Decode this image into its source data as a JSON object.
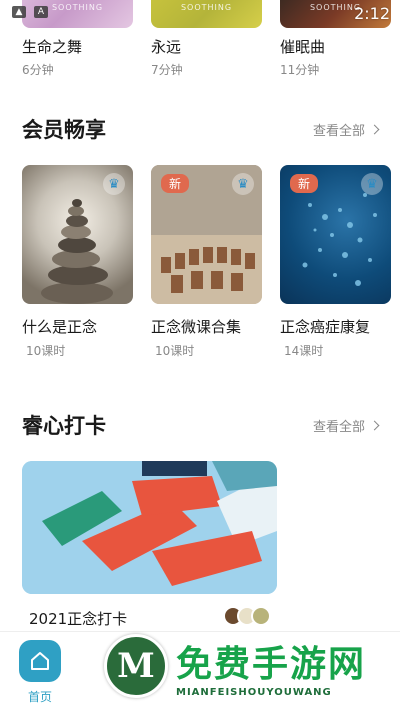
{
  "status": {
    "time": "2:12"
  },
  "top_tracks": [
    {
      "title": "生命之舞",
      "duration": "6分钟",
      "brand": "SOOTHING"
    },
    {
      "title": "永远",
      "duration": "7分钟",
      "brand": "SOOTHING"
    },
    {
      "title": "催眠曲",
      "duration": "11分钟",
      "brand": "SOOTHING"
    }
  ],
  "member_section": {
    "title": "会员畅享",
    "view_all": "查看全部",
    "items": [
      {
        "title": "什么是正念",
        "lessons": "10课时",
        "badge": ""
      },
      {
        "title": "正念微课合集",
        "lessons": "10课时",
        "badge": "新"
      },
      {
        "title": "正念癌症康复",
        "lessons": "14课时",
        "badge": "新"
      }
    ]
  },
  "checkin_section": {
    "title": "睿心打卡",
    "view_all": "查看全部",
    "card_title": "2021正念打卡"
  },
  "bottom_nav": {
    "home_label": "首页"
  },
  "watermark": {
    "logo_letter": "M",
    "text": "免费手游网",
    "subtext": "MIANFEISHOUYOUWANG"
  },
  "colors": {
    "accent": "#2fa0c4",
    "new_badge": "#e0694e",
    "watermark_green": "#17a34a"
  }
}
